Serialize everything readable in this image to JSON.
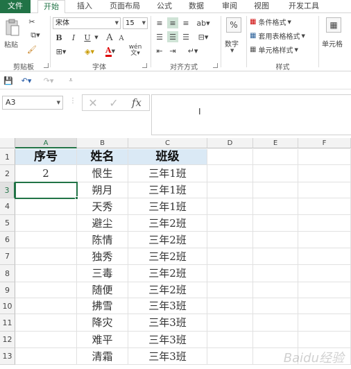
{
  "tabs": [
    "文件",
    "开始",
    "插入",
    "页面布局",
    "公式",
    "数据",
    "审阅",
    "视图",
    "开发工具"
  ],
  "ribbon": {
    "clipboard": {
      "paste_label": "粘贴",
      "group_label": "剪贴板"
    },
    "font": {
      "name": "宋体",
      "size": "15",
      "group_label": "字体",
      "bold": "B",
      "italic": "I",
      "underline": "U",
      "font_color_glyph": "A",
      "grow": "A",
      "shrink": "A",
      "pinyin": "wén"
    },
    "alignment": {
      "group_label": "对齐方式"
    },
    "number": {
      "percent": "%",
      "label": "数字"
    },
    "styles": {
      "conditional": "条件格式",
      "table": "套用表格格式",
      "cell": "单元格样式",
      "group_label": "样式"
    },
    "cells": {
      "label": "单元格"
    }
  },
  "formula_bar": {
    "name_box": "A3",
    "fx": "fx",
    "value": ""
  },
  "columns": [
    "A",
    "B",
    "C",
    "D",
    "E",
    "F"
  ],
  "selected_column": "A",
  "selected_row": 3,
  "header_row": [
    "序号",
    "姓名",
    "班级"
  ],
  "rows": [
    [
      "2",
      "恨生",
      "三年1班"
    ],
    [
      "",
      "朔月",
      "三年1班"
    ],
    [
      "",
      "天秀",
      "三年1班"
    ],
    [
      "",
      "避尘",
      "三年2班"
    ],
    [
      "",
      "陈情",
      "三年2班"
    ],
    [
      "",
      "独秀",
      "三年2班"
    ],
    [
      "",
      "三毒",
      "三年2班"
    ],
    [
      "",
      "随便",
      "三年2班"
    ],
    [
      "",
      "拂雪",
      "三年3班"
    ],
    [
      "",
      "降灾",
      "三年3班"
    ],
    [
      "",
      "难平",
      "三年3班"
    ],
    [
      "",
      "清霜",
      "三年3班"
    ]
  ],
  "row_numbers": [
    "1",
    "2",
    "3",
    "4",
    "5",
    "6",
    "7",
    "8",
    "9",
    "10",
    "11",
    "12",
    "13"
  ],
  "watermark": "Baidu经验",
  "colors": {
    "accent": "#217346",
    "header_fill": "#dae9f5"
  }
}
